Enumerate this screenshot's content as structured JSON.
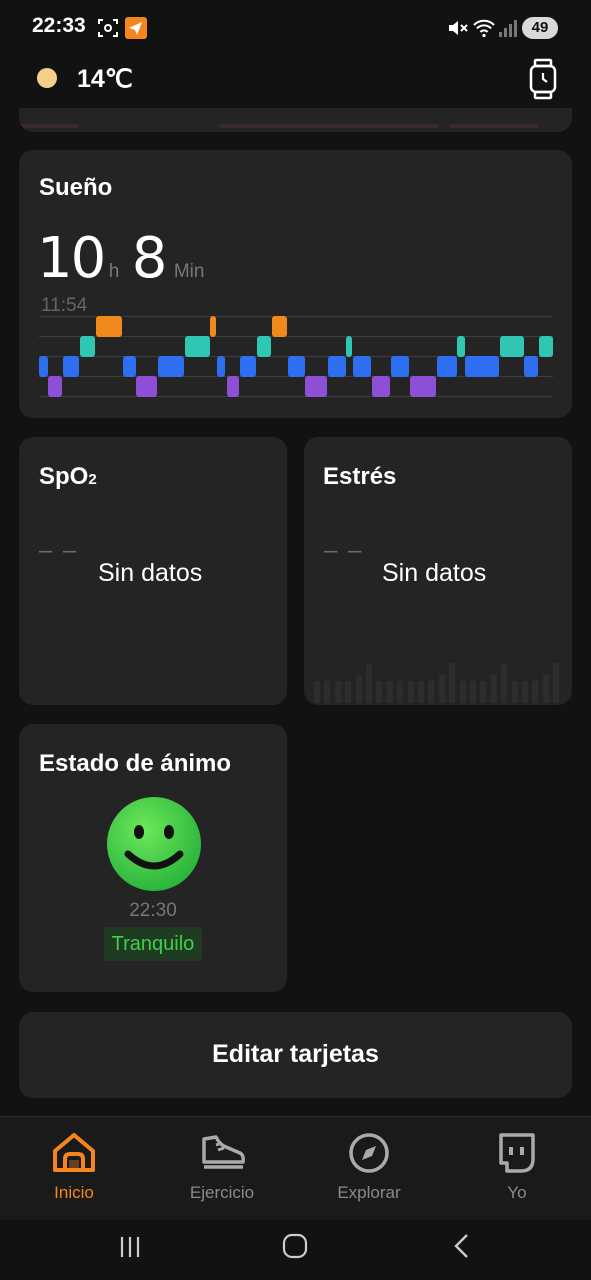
{
  "status_bar": {
    "time": "22:33",
    "battery": "49"
  },
  "header": {
    "temperature": "14℃"
  },
  "sleep": {
    "title": "Sueño",
    "hours": "10",
    "hours_unit": "h",
    "minutes": "8",
    "minutes_unit": "Min",
    "start_time": "11:54",
    "stage_colors": {
      "awake": "#f08a1c",
      "rem": "#2fc6b4",
      "light": "#2e6ef0",
      "deep": "#8d4fd6"
    }
  },
  "spo2": {
    "title_main": "SpO",
    "title_sub": "2",
    "dash": "– –",
    "no_data": "Sin datos"
  },
  "stress": {
    "title": "Estrés",
    "dash": "– –",
    "no_data": "Sin datos"
  },
  "mood": {
    "title": "Estado de ánimo",
    "time": "22:30",
    "state": "Tranquilo"
  },
  "edit_cards": {
    "label": "Editar tarjetas"
  },
  "nav": {
    "items": [
      {
        "label": "Inicio",
        "icon": "home-icon",
        "active": true
      },
      {
        "label": "Ejercicio",
        "icon": "shoe-icon",
        "active": false
      },
      {
        "label": "Explorar",
        "icon": "compass-icon",
        "active": false
      },
      {
        "label": "Yo",
        "icon": "profile-icon",
        "active": false
      }
    ]
  }
}
